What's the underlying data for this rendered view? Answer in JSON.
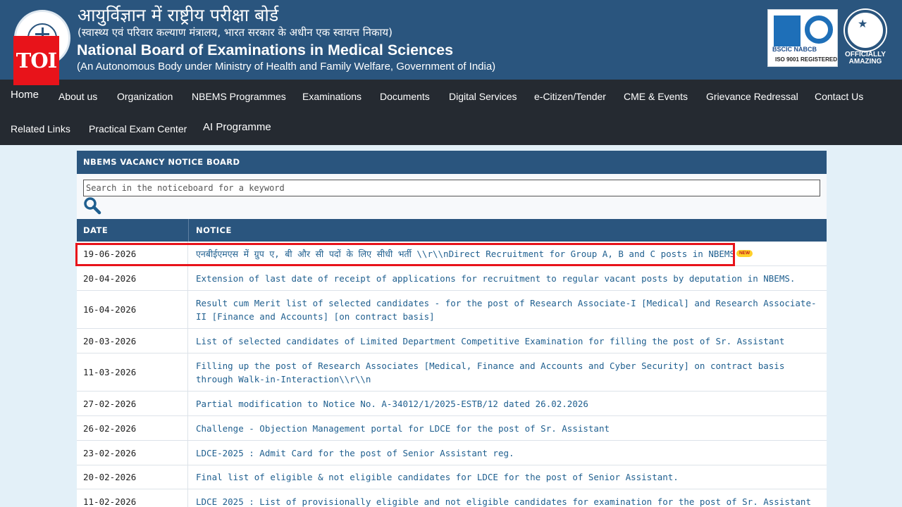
{
  "header": {
    "hindi_title": "आयुर्विज्ञान में राष्ट्रीय परीक्षा बोर्ड",
    "hindi_subtitle": "(स्वास्थ्य एवं परिवार कल्याण मंत्रालय, भारत सरकार के अधीन एक स्वायत्त निकाय)",
    "title": "National Board of Examinations in Medical Sciences",
    "subtitle": "(An Autonomous Body under Ministry of Health and Family Welfare, Government of India)",
    "watermark": "TOI",
    "cert_badge": {
      "line1": "BSCIC NABCB",
      "line2": "ISO 9001 REGISTERED"
    },
    "guinness": {
      "line1": "OFFICIALLY",
      "line2": "AMAZING"
    }
  },
  "nav": {
    "items": [
      {
        "label": "Home"
      },
      {
        "label": "About us"
      },
      {
        "label": "Organization"
      },
      {
        "label": "NBEMS Programmes"
      },
      {
        "label": "Examinations"
      },
      {
        "label": "Documents"
      },
      {
        "label": "Digital Services"
      },
      {
        "label": "e-Citizen/Tender"
      },
      {
        "label": "CME & Events"
      },
      {
        "label": "Grievance Redressal"
      },
      {
        "label": "Contact Us"
      },
      {
        "label": "Related Links"
      },
      {
        "label": "Practical Exam Center"
      },
      {
        "label": "AI Programme"
      }
    ]
  },
  "board": {
    "title": "NBEMS VACANCY NOTICE BOARD",
    "search_placeholder": "Search in the noticeboard for a keyword",
    "columns": {
      "date": "DATE",
      "notice": "NOTICE"
    },
    "new_badge": "NEW",
    "rows": [
      {
        "date": "19-06-2026",
        "notice": "एनबीईएमएस में ग्रुप ए, बी और सी पदों के लिए सीधी भर्ती \\\\r\\\\nDirect Recruitment for Group A, B and C posts in NBEMS",
        "is_new": true,
        "highlighted": true
      },
      {
        "date": "20-04-2026",
        "notice": "Extension of last date of receipt of applications for recruitment to regular vacant posts by deputation in NBEMS."
      },
      {
        "date": "16-04-2026",
        "notice": "Result cum Merit list of selected candidates - for the post of Research Associate-I [Medical] and Research Associate-II [Finance and Accounts] [on contract basis]"
      },
      {
        "date": "20-03-2026",
        "notice": "List of selected candidates of Limited Department Competitive Examination for filling the post of Sr. Assistant"
      },
      {
        "date": "11-03-2026",
        "notice": "Filling up the post of Research Associates [Medical, Finance and Accounts and Cyber Security] on contract basis through Walk-in-Interaction\\\\r\\\\n"
      },
      {
        "date": "27-02-2026",
        "notice": "Partial modification to Notice No. A-34012/1/2025-ESTB/12 dated 26.02.2026"
      },
      {
        "date": "26-02-2026",
        "notice": "Challenge - Objection Management portal for LDCE for the post of Sr. Assistant"
      },
      {
        "date": "23-02-2026",
        "notice": "LDCE-2025 : Admit Card for the post of Senior Assistant reg."
      },
      {
        "date": "20-02-2026",
        "notice": "Final list of eligible & not eligible candidates for LDCE for the post of Senior Assistant."
      },
      {
        "date": "11-02-2026",
        "notice": "LDCE 2025 : List of provisionally eligible and not eligible candidates for examination for the post of Sr. Assistant"
      }
    ]
  },
  "colors": {
    "header_bg": "#2a557e",
    "nav_bg": "#252a31",
    "page_bg": "#e3f0f8",
    "link": "#1f5f8f",
    "highlight": "#e8131a"
  }
}
